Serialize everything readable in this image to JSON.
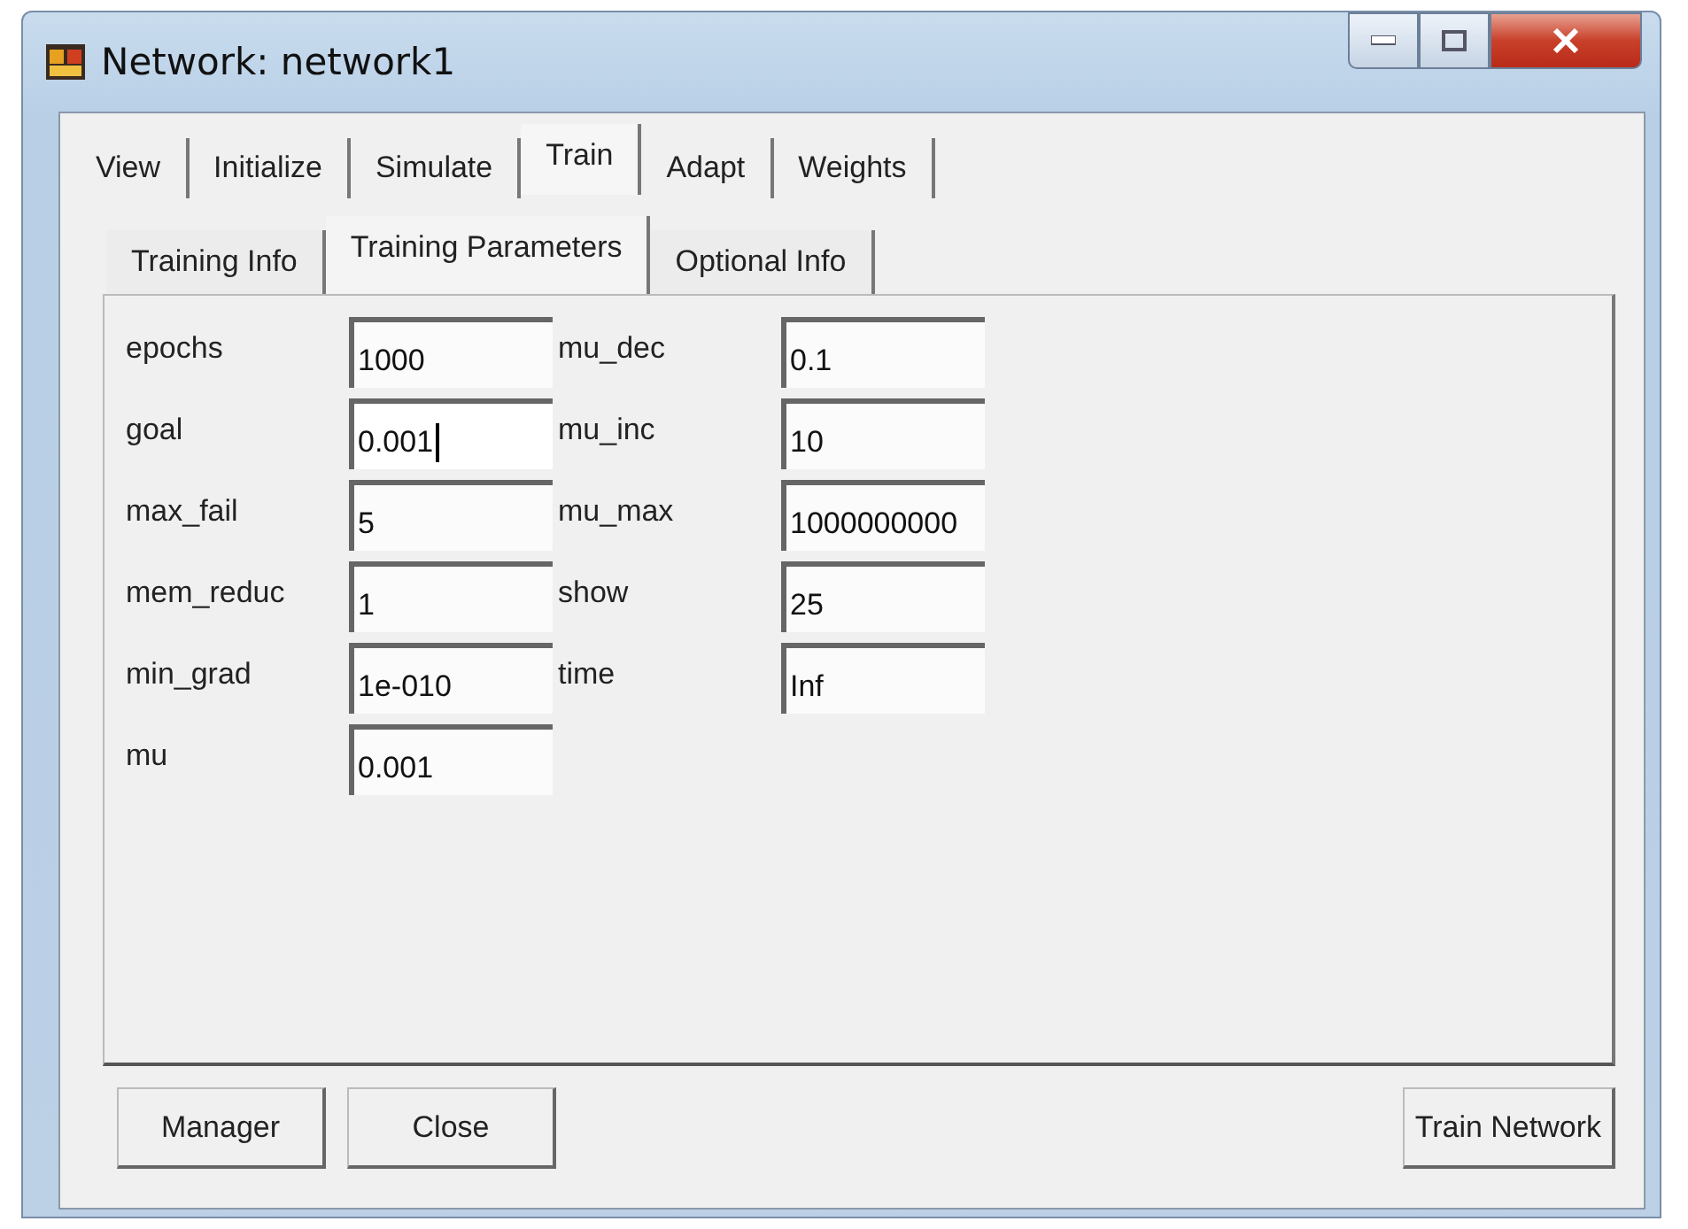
{
  "window": {
    "title": "Network: network1"
  },
  "tabs": [
    {
      "label": "View",
      "selected": false
    },
    {
      "label": "Initialize",
      "selected": false
    },
    {
      "label": "Simulate",
      "selected": false
    },
    {
      "label": "Train",
      "selected": true
    },
    {
      "label": "Adapt",
      "selected": false
    },
    {
      "label": "Weights",
      "selected": false
    }
  ],
  "subtabs": [
    {
      "label": "Training Info",
      "selected": false
    },
    {
      "label": "Training Parameters",
      "selected": true
    },
    {
      "label": "Optional Info",
      "selected": false
    }
  ],
  "parameters": [
    {
      "label": "epochs",
      "value": "1000",
      "focused": false
    },
    {
      "label": "goal",
      "value": "0.001",
      "focused": true
    },
    {
      "label": "max_fail",
      "value": "5",
      "focused": false
    },
    {
      "label": "mem_reduc",
      "value": "1",
      "focused": false
    },
    {
      "label": "min_grad",
      "value": "1e-010",
      "focused": false
    },
    {
      "label": "mu",
      "value": "0.001",
      "focused": false
    },
    {
      "label": "mu_dec",
      "value": "0.1",
      "focused": false
    },
    {
      "label": "mu_inc",
      "value": "10",
      "focused": false
    },
    {
      "label": "mu_max",
      "value": "1000000000",
      "focused": false
    },
    {
      "label": "show",
      "value": "25",
      "focused": false
    },
    {
      "label": "time",
      "value": "Inf",
      "focused": false
    }
  ],
  "buttons_left": [
    "Manager",
    "Close"
  ],
  "buttons_right": [
    "Train Network"
  ]
}
